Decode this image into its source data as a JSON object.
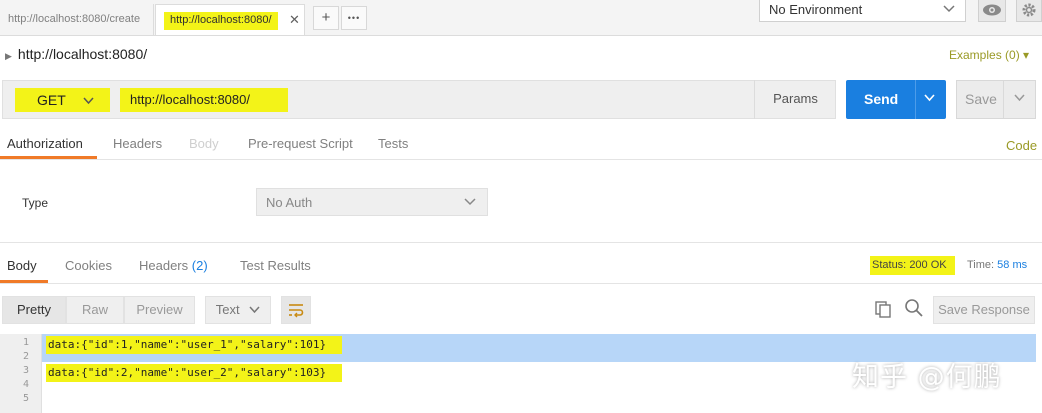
{
  "tabs": [
    {
      "label": "http://localhost:8080/create"
    },
    {
      "label": "http://localhost:8080/"
    }
  ],
  "tab_close": "✕",
  "tab_actions": {
    "add": "+",
    "more": "•••"
  },
  "environment": {
    "selected": "No Environment"
  },
  "request": {
    "title": "http://localhost:8080/",
    "examples": "Examples (0) ▾",
    "method": "GET",
    "url": "http://localhost:8080/",
    "params_label": "Params",
    "send_label": "Send",
    "save_label": "Save"
  },
  "request_tabs": [
    {
      "label": "Authorization"
    },
    {
      "label": "Headers"
    },
    {
      "label": "Body"
    },
    {
      "label": "Pre-request Script"
    },
    {
      "label": "Tests"
    }
  ],
  "code_link": "Code",
  "auth": {
    "type_label": "Type",
    "selected": "No Auth"
  },
  "response_tabs": [
    {
      "label": "Body"
    },
    {
      "label": "Cookies"
    },
    {
      "label": "Headers",
      "count": "(2)"
    },
    {
      "label": "Test Results"
    }
  ],
  "status": {
    "label": "Status:",
    "value": "200 OK",
    "time_label": "Time:",
    "time_value": "58 ms"
  },
  "response_toolbar": {
    "pretty": "Pretty",
    "raw": "Raw",
    "preview": "Preview",
    "format": "Text",
    "save_response": "Save Response"
  },
  "response_lines": [
    {
      "num": "1",
      "text": "data:{\"id\":1,\"name\":\"user_1\",\"salary\":101}"
    },
    {
      "num": "2",
      "text": ""
    },
    {
      "num": "3",
      "text": "data:{\"id\":2,\"name\":\"user_2\",\"salary\":103}"
    },
    {
      "num": "4",
      "text": ""
    },
    {
      "num": "5",
      "text": ""
    }
  ],
  "watermark": "知乎 @何鹏",
  "colors": {
    "accent": "#f07a28",
    "send": "#1a7fe0",
    "highlight": "#f3f318",
    "selection": "#b7d6f8"
  }
}
